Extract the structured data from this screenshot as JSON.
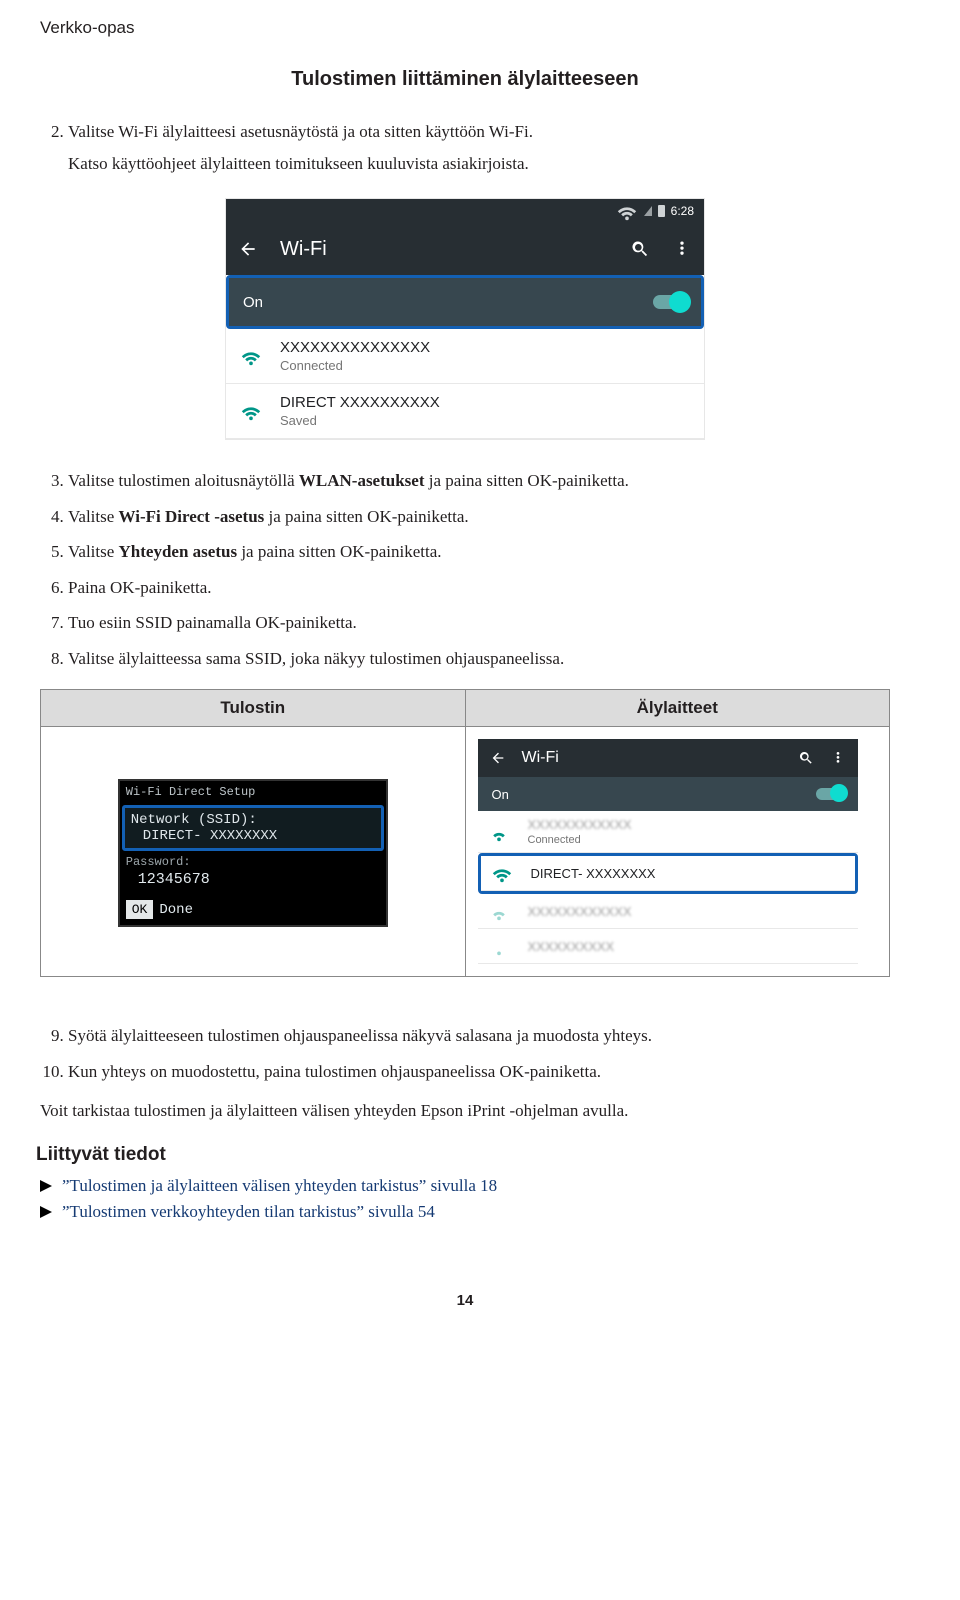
{
  "header": {
    "doc_title": "Verkko-opas",
    "section_title": "Tulostimen liittäminen älylaitteeseen"
  },
  "steps_a": {
    "s2_a": "Valitse Wi-Fi älylaitteesi asetusnäytöstä ja ota sitten käyttöön Wi-Fi.",
    "s2_b": "Katso käyttöohjeet älylaitteen toimitukseen kuuluvista asiakirjoista."
  },
  "phone1": {
    "clock": "6:28",
    "title": "Wi-Fi",
    "on": "On",
    "net1_ssid": "XXXXXXXXXXXXXXX",
    "net1_status": "Connected",
    "net2_ssid": "DIRECT  XXXXXXXXXX",
    "net2_status": "Saved"
  },
  "steps_b": {
    "s3_a": "Valitse tulostimen aloitusnäytöllä ",
    "s3_b": "WLAN-asetukset",
    "s3_c": " ja paina sitten OK-painiketta.",
    "s4_a": "Valitse ",
    "s4_b": "Wi-Fi Direct -asetus",
    "s4_c": " ja paina sitten OK-painiketta.",
    "s5_a": "Valitse ",
    "s5_b": "Yhteyden asetus",
    "s5_c": " ja paina sitten OK-painiketta.",
    "s6": "Paina OK-painiketta.",
    "s7": "Tuo esiin SSID painamalla OK-painiketta.",
    "s8": "Valitse älylaitteessa sama SSID, joka näkyy tulostimen ohjauspaneelissa."
  },
  "table": {
    "th1": "Tulostin",
    "th2": "Älylaitteet"
  },
  "lcd": {
    "title": "Wi-Fi Direct Setup",
    "l1": "Network (SSID):",
    "v1": "DIRECT- XXXXXXXX",
    "l2": "Password:",
    "v2": "12345678",
    "ok": "OK",
    "done": "Done"
  },
  "phone2": {
    "title": "Wi-Fi",
    "on": "On",
    "connected": "Connected",
    "direct": "DIRECT- XXXXXXXX"
  },
  "steps_c": {
    "s9": "Syötä älylaitteeseen tulostimen ohjauspaneelissa näkyvä salasana ja muodosta yhteys.",
    "s10": "Kun yhteys on muodostettu, paina tulostimen ohjauspaneelissa OK-painiketta."
  },
  "para": "Voit tarkistaa tulostimen ja älylaitteen välisen yhteyden Epson iPrint -ohjelman avulla.",
  "related": {
    "title": "Liittyvät tiedot",
    "l1": "”Tulostimen ja älylaitteen välisen yhteyden tarkistus” sivulla 18",
    "l2": "”Tulostimen verkkoyhteyden tilan tarkistus” sivulla 54"
  },
  "pagenum": "14"
}
